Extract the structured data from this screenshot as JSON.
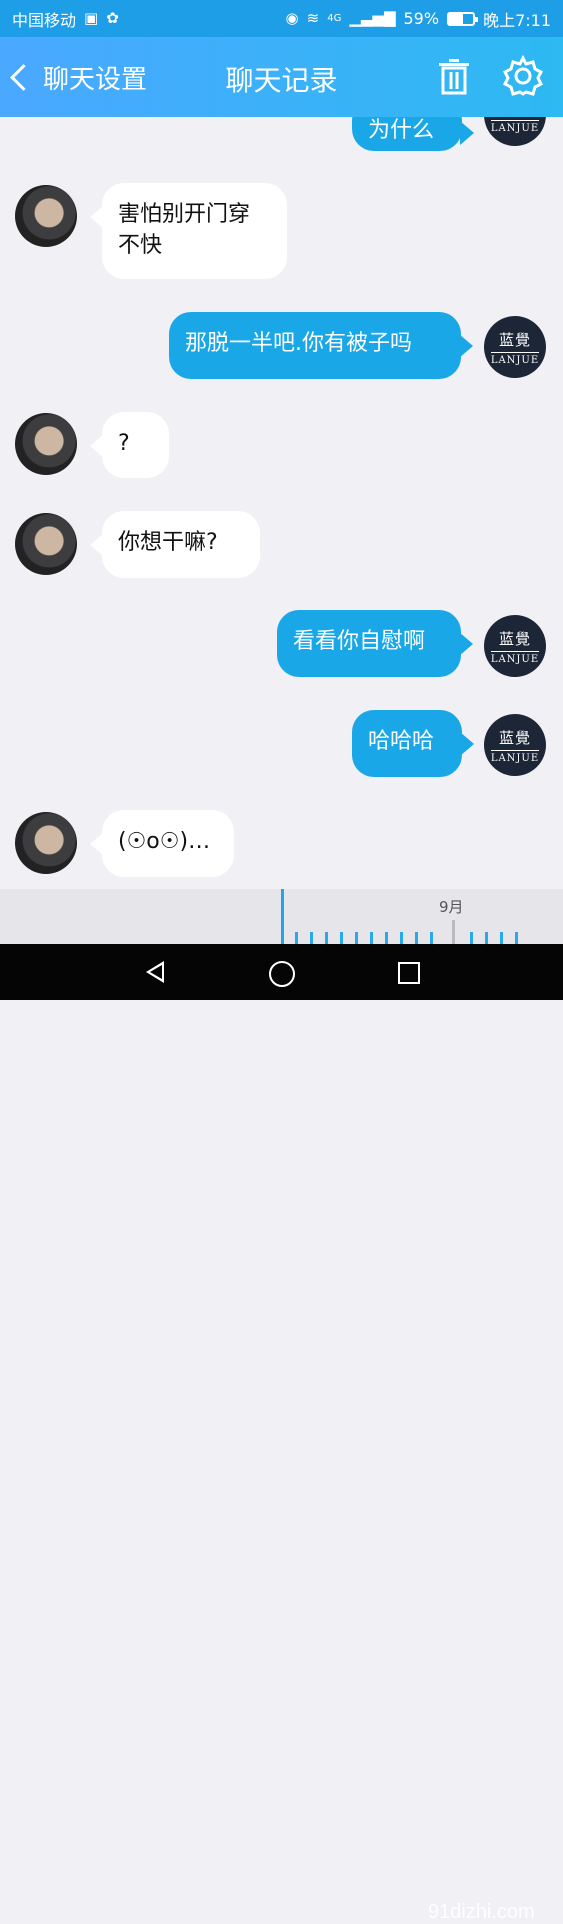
{
  "status_bar": {
    "carrier": "中国移动",
    "battery_percent": "59%",
    "time": "晚上7:11",
    "signal_type": "4G",
    "battery_level": 0.59
  },
  "header": {
    "back_label": "聊天设置",
    "title": "聊天记录"
  },
  "messages": [
    {
      "side": "right",
      "text": "为什么"
    },
    {
      "side": "left",
      "text": "害怕别开门穿\n不快"
    },
    {
      "side": "right",
      "text": "那脱一半吧.你有被子吗"
    },
    {
      "side": "left",
      "text": "?"
    },
    {
      "side": "left",
      "text": "你想干嘛?"
    },
    {
      "side": "right",
      "text": "看看你自慰啊"
    },
    {
      "side": "right",
      "text": "哈哈哈"
    },
    {
      "side": "left",
      "text": "(☉o☉)…"
    }
  ],
  "timeline": {
    "month_label": "9月"
  },
  "avatar_logo": {
    "top": "蓝覺",
    "bottom": "LANJUE"
  },
  "watermark": {
    "text": "91dizhi.com"
  }
}
